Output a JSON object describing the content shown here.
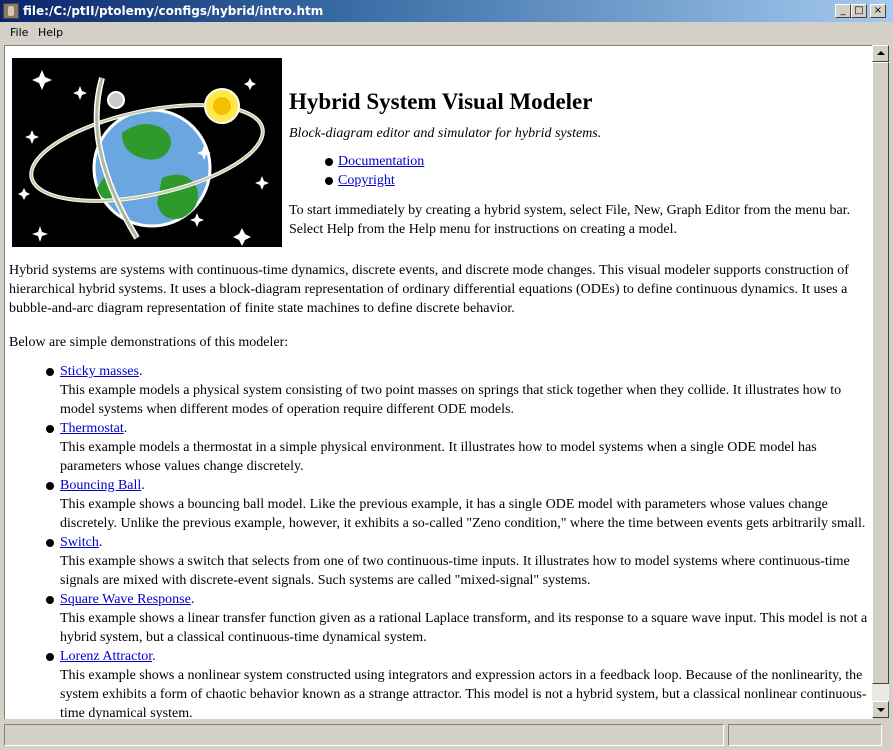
{
  "window": {
    "title": "file:/C:/ptII/ptolemy/configs/hybrid/intro.htm",
    "min_glyph": "_",
    "max_glyph": "□",
    "close_glyph": "×"
  },
  "menu": {
    "file": "File",
    "help": "Help"
  },
  "header": {
    "title": "Hybrid System Visual Modeler",
    "subtitle": "Block-diagram editor and simulator for hybrid systems.",
    "links": [
      {
        "label": "Documentation"
      },
      {
        "label": "Copyright"
      }
    ],
    "intro": "To start immediately by creating a hybrid system, select File, New, Graph Editor from the menu bar. Select Help from the Help menu for instructions on creating a model."
  },
  "body": {
    "para1": "Hybrid systems are systems with continuous-time dynamics, discrete events, and discrete mode changes. This visual modeler supports construction of hierarchical hybrid systems. It uses a block-diagram representation of ordinary differential equations (ODEs) to define continuous dynamics. It uses a bubble-and-arc diagram representation of finite state machines to define discrete behavior.",
    "para2": "Below are simple demonstrations of this modeler:"
  },
  "demos": [
    {
      "label": "Sticky masses",
      "desc": "This example models a physical system consisting of two point masses on springs that stick together when they collide. It illustrates how to model systems when different modes of operation require different ODE models."
    },
    {
      "label": "Thermostat",
      "desc": "This example models a thermostat in a simple physical environment. It illustrates how to model systems when a single ODE model has parameters whose values change discretely."
    },
    {
      "label": "Bouncing Ball",
      "desc": "This example shows a bouncing ball model. Like the previous example, it has a single ODE model with parameters whose values change discretely. Unlike the previous example, however, it exhibits a so-called \"Zeno condition,\" where the time between events gets arbitrarily small."
    },
    {
      "label": "Switch",
      "desc": "This example shows a switch that selects from one of two continuous-time inputs. It illustrates how to model systems where continuous-time signals are mixed with discrete-event signals. Such systems are called \"mixed-signal\" systems."
    },
    {
      "label": "Square Wave Response",
      "desc": "This example shows a linear transfer function given as a rational Laplace transform, and its response to a square wave input. This model is not a hybrid system, but a classical continuous-time dynamical system."
    },
    {
      "label": "Lorenz Attractor",
      "desc": "This example shows a nonlinear system constructed using integrators and expression actors in a feedback loop. Because of the nonlinearity, the system exhibits a form of chaotic behavior known as a strange attractor. This model is not a hybrid system, but a classical nonlinear continuous-time dynamical system."
    }
  ],
  "punct": "."
}
